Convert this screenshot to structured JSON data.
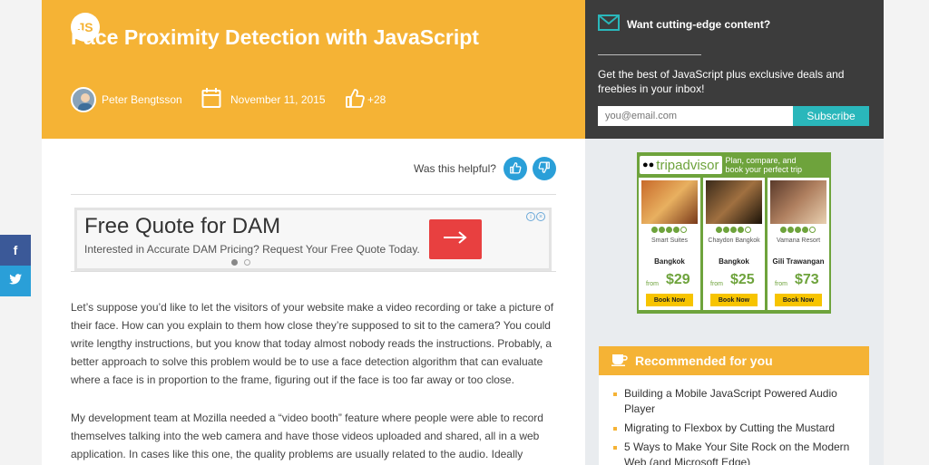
{
  "header": {
    "logo": "JS",
    "title": "Face Proximity Detection with JavaScript",
    "author": "Peter Bengtsson",
    "date": "November 11, 2015",
    "likes": "+28",
    "accent_color": "#f5b335"
  },
  "newsletter": {
    "heading": "Want cutting-edge content?",
    "text": "Get the best of JavaScript plus exclusive deals and freebies in your inbox!",
    "email_placeholder": "you@email.com",
    "subscribe_label": "Subscribe"
  },
  "feedback": {
    "question": "Was this helpful?"
  },
  "ad": {
    "title": "Free Quote for DAM",
    "text": "Interested in Accurate DAM Pricing? Request Your Free Quote Today."
  },
  "article": {
    "paragraphs": [
      "Let’s suppose you’d like to let the visitors of your website make a video recording or take a picture of their face. How can you explain to them how close they’re supposed to sit to the camera? You could write lengthy instructions, but you know that today almost nobody reads the instructions. Probably, a better approach to solve this problem would be to use a face detection algorithm that can evaluate where a face is in proportion to the frame, figuring out if the face is too far away or too close.",
      "My development team at Mozilla needed a “video booth” feature where people were able to record themselves talking into the web camera and have those videos uploaded and shared, all in a web application. In cases like this one, the quality problems are usually related to the audio. Ideally people"
    ]
  },
  "tripadvisor": {
    "brand": "tripadvisor",
    "tagline": "Plan, compare, and book your perfect trip",
    "from_label": "from",
    "book_label": "Book Now",
    "hotels": [
      {
        "name": "Smart Suites",
        "city": "Bangkok",
        "price": "$29"
      },
      {
        "name": "Chaydon Bangkok",
        "city": "Bangkok",
        "price": "$25"
      },
      {
        "name": "Vamana Resort",
        "city": "Gili Trawangan",
        "price": "$73"
      }
    ]
  },
  "recommended": {
    "heading": "Recommended for you",
    "items": [
      "Building a Mobile JavaScript Powered Audio Player",
      "Migrating to Flexbox by Cutting the Mustard",
      "5 Ways to Make Your Site Rock on the Modern Web (and Microsoft Edge)"
    ]
  },
  "social": {
    "facebook_label": "f"
  }
}
